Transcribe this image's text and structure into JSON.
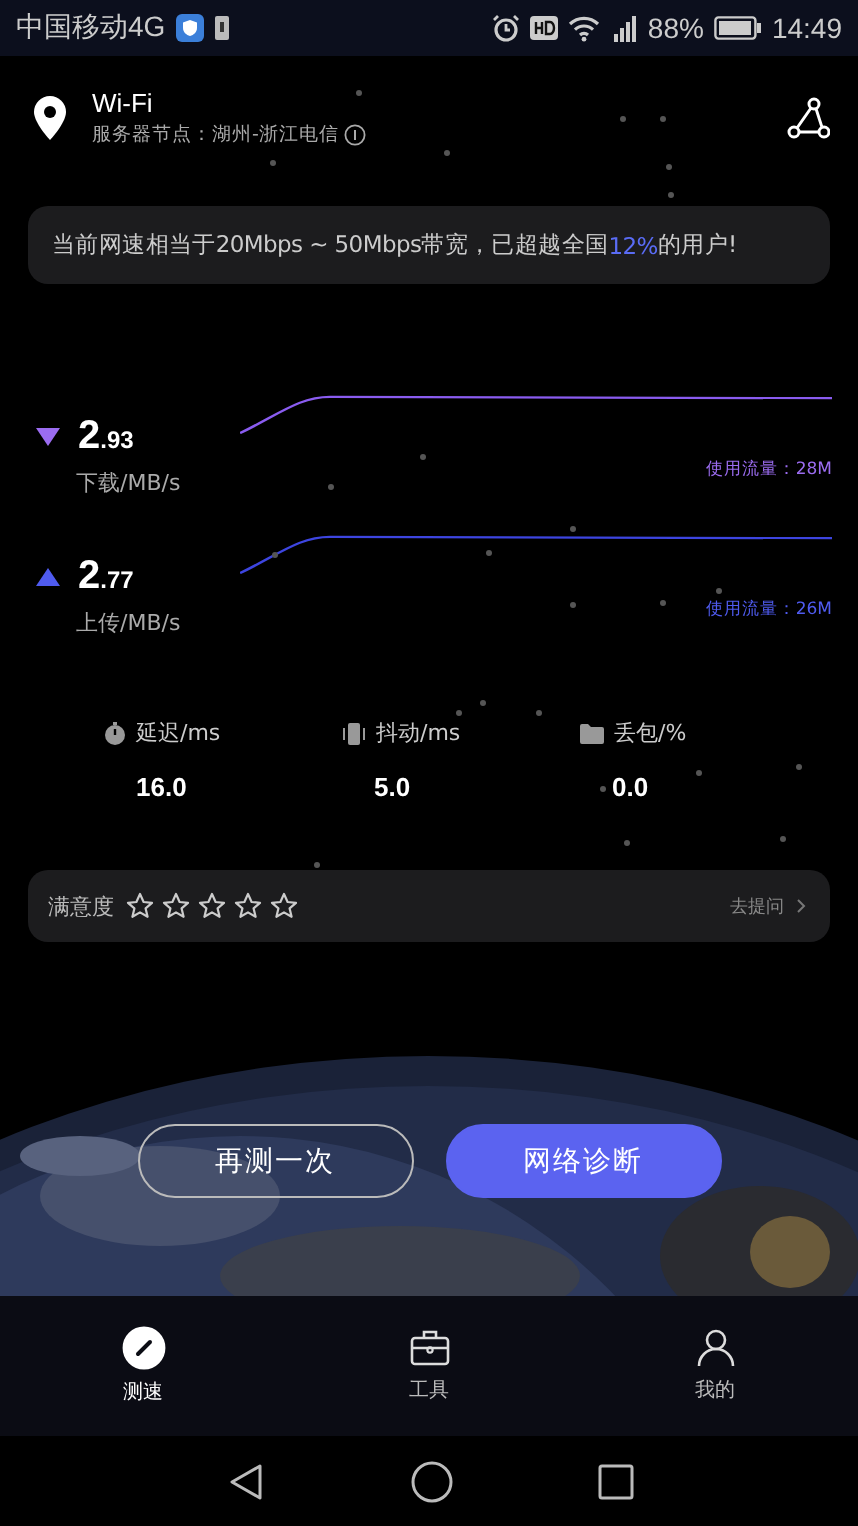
{
  "status_bar": {
    "carrier": "中国移动4G",
    "battery": "88%",
    "time": "14:49"
  },
  "header": {
    "network": "Wi-Fi",
    "server": "服务器节点：湖州-浙江电信"
  },
  "banner": {
    "before": "当前网速相当于20Mbps ~ 50Mbps带宽，已超越全国",
    "highlight": "12%",
    "after": "的用户!"
  },
  "speeds": [
    {
      "kind": "download",
      "int": "2",
      "dec": ".93",
      "label": "下载/MB/s",
      "usage": "使用流量：28M"
    },
    {
      "kind": "upload",
      "int": "2",
      "dec": ".77",
      "label": "上传/MB/s",
      "usage": "使用流量：26M"
    }
  ],
  "metrics": [
    {
      "kind": "latency",
      "label": "延迟/ms",
      "value": "16.0"
    },
    {
      "kind": "jitter",
      "label": "抖动/ms",
      "value": "5.0"
    },
    {
      "kind": "loss",
      "label": "丢包/%",
      "value": "0.0"
    }
  ],
  "rating": {
    "label": "满意度",
    "stars": 0,
    "link": "去提问"
  },
  "buttons": [
    {
      "label": "再测一次",
      "kind": "outline"
    },
    {
      "label": "网络诊断",
      "kind": "primary"
    }
  ],
  "tabs": [
    {
      "label": "测速",
      "kind": "speed",
      "selected": true
    },
    {
      "label": "工具",
      "kind": "tools",
      "selected": false
    },
    {
      "label": "我的",
      "kind": "me",
      "selected": false
    }
  ]
}
